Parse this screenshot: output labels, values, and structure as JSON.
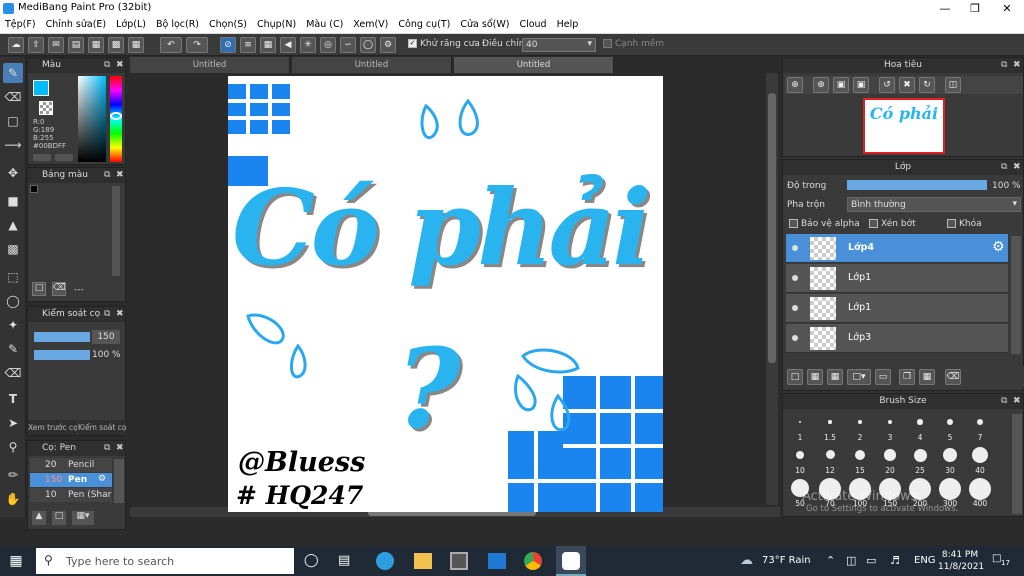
{
  "window": {
    "title": "MediBang Paint Pro (32bit)"
  },
  "menu": [
    "Tệp(F)",
    "Chỉnh sửa(E)",
    "Lớp(L)",
    "Bộ lọc(R)",
    "Chọn(S)",
    "Chụp(N)",
    "Màu (C)",
    "Xem(V)",
    "Công cụ(T)",
    "Cửa sổ(W)",
    "Cloud",
    "Help"
  ],
  "toolbar": {
    "antialias_label": "Khử răng cưa",
    "adjust_label": "Điều chỉnh",
    "adjust_value": "40",
    "edge_label": "Cạnh mềm"
  },
  "color_panel": {
    "title": "Màu",
    "r": "R:0",
    "g": "G:189",
    "b": "B:255",
    "hex": "#00BDFF",
    "main_color": "#00BDFF"
  },
  "palette_panel": {
    "title": "Bảng màu",
    "more": "---"
  },
  "brush_control": {
    "title": "Kiểm soát cọ",
    "size": "150",
    "opacity": "100 %",
    "tab1": "Xem trước cọ",
    "tab2": "Kiểm soát cọ"
  },
  "brush_list": {
    "title": "Cọ: Pen",
    "items": [
      {
        "size": "20",
        "name": "Pencil"
      },
      {
        "size": "150",
        "name": "Pen"
      },
      {
        "size": "10",
        "name": "Pen (Shar"
      }
    ]
  },
  "doc_tabs": [
    "Untitled",
    "Untitled",
    "Untitled"
  ],
  "canvas": {
    "main_text": "Có phải",
    "question": "?",
    "sig1": "@Bluess",
    "sig2": "# HQ247"
  },
  "navigator": {
    "title": "Hoa tiêu"
  },
  "layer_panel": {
    "title": "Lớp",
    "opacity_label": "Độ trong",
    "opacity_value": "100 %",
    "opacity_fraction": 1.0,
    "blend_label": "Pha trộn",
    "blend_value": "Bình thường",
    "protect_alpha": "Bảo vệ alpha",
    "clip": "Xén bớt",
    "lock": "Khóa",
    "layers": [
      "Lớp4",
      "Lớp1",
      "Lớp1",
      "Lớp3"
    ]
  },
  "brush_size_panel": {
    "title": "Brush Size",
    "sizes": [
      "1",
      "1.5",
      "2",
      "3",
      "4",
      "5",
      "7",
      "10",
      "12",
      "15",
      "20",
      "25",
      "30",
      "40",
      "50",
      "70",
      "100",
      "150",
      "200",
      "300",
      "400"
    ]
  },
  "watermark": {
    "line1": "Activate Windows",
    "line2": "Go to Settings to activate Windows."
  },
  "taskbar": {
    "search_placeholder": "Type here to search",
    "weather": "73°F  Rain",
    "lang": "ENG",
    "time": "8:41 PM",
    "date": "11/8/2021",
    "notif": "17"
  }
}
